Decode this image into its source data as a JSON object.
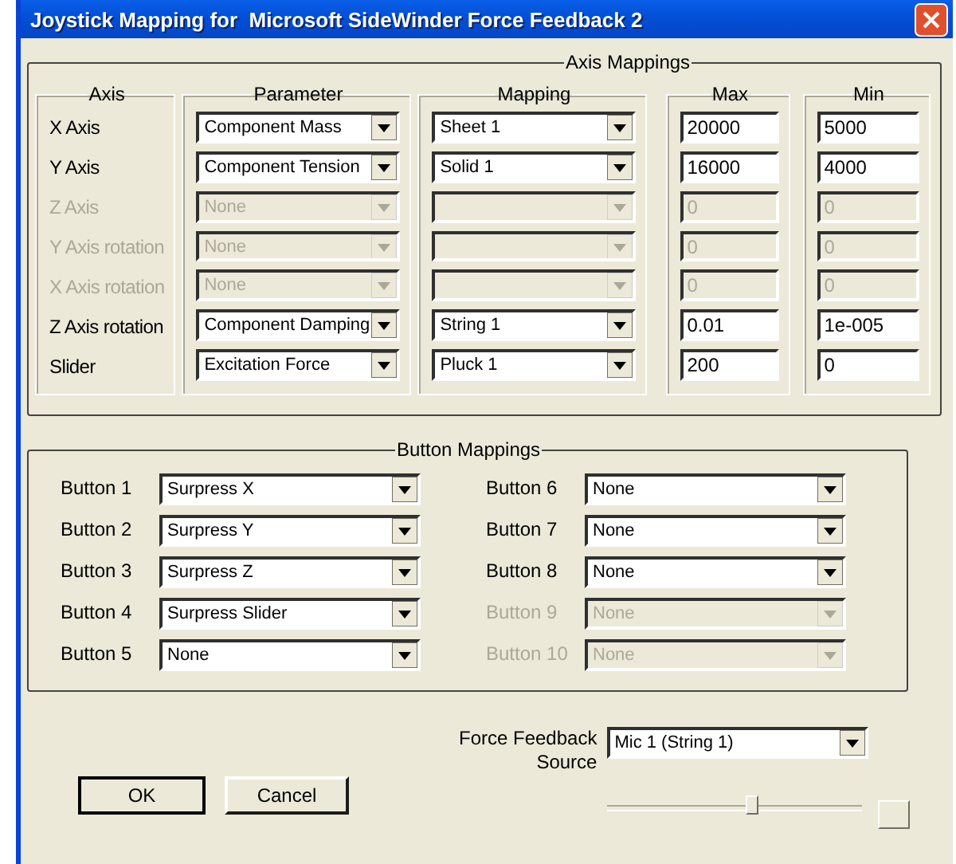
{
  "window": {
    "title": "Joystick Mapping for  Microsoft SideWinder Force Feedback 2"
  },
  "axis_mappings": {
    "title": "Axis Mappings",
    "headers": {
      "axis": "Axis",
      "parameter": "Parameter",
      "mapping": "Mapping",
      "max": "Max",
      "min": "Min"
    },
    "rows": [
      {
        "axis": "X Axis",
        "disabled": false,
        "parameter": "Component Mass",
        "mapping": "Sheet 1",
        "max": "20000",
        "min": "5000"
      },
      {
        "axis": "Y Axis",
        "disabled": false,
        "parameter": "Component Tension",
        "mapping": "Solid 1",
        "max": "16000",
        "min": "4000"
      },
      {
        "axis": "Z Axis",
        "disabled": true,
        "parameter": "None",
        "mapping": null,
        "max": "0",
        "min": "0"
      },
      {
        "axis": "Y Axis rotation",
        "disabled": true,
        "parameter": "None",
        "mapping": null,
        "max": "0",
        "min": "0"
      },
      {
        "axis": "X Axis rotation",
        "disabled": true,
        "parameter": "None",
        "mapping": null,
        "max": "0",
        "min": "0"
      },
      {
        "axis": "Z Axis rotation",
        "disabled": false,
        "parameter": "Component Damping",
        "mapping": "String 1",
        "max": "0.01",
        "min": "1e-005"
      },
      {
        "axis": "Slider",
        "disabled": false,
        "parameter": "Excitation Force",
        "mapping": "Pluck 1",
        "max": "200",
        "min": "0"
      }
    ]
  },
  "button_mappings": {
    "title": "Button Mappings",
    "buttons": [
      {
        "label": "Button 1",
        "value": "Surpress X",
        "disabled": false
      },
      {
        "label": "Button 2",
        "value": "Surpress Y",
        "disabled": false
      },
      {
        "label": "Button 3",
        "value": "Surpress Z",
        "disabled": false
      },
      {
        "label": "Button 4",
        "value": "Surpress Slider",
        "disabled": false
      },
      {
        "label": "Button 5",
        "value": "None",
        "disabled": false
      },
      {
        "label": "Button 6",
        "value": "None",
        "disabled": false
      },
      {
        "label": "Button 7",
        "value": "None",
        "disabled": false
      },
      {
        "label": "Button 8",
        "value": "None",
        "disabled": false
      },
      {
        "label": "Button 9",
        "value": "None",
        "disabled": true
      },
      {
        "label": "Button 10",
        "value": "None",
        "disabled": true
      }
    ]
  },
  "force_feedback": {
    "label_line1": "Force Feedback",
    "label_line2": "Source",
    "value": "Mic 1 (String 1)",
    "slider": {
      "level": 0.57
    }
  },
  "buttons": [
    {
      "label": "OK",
      "default": true
    },
    {
      "label": "Cancel",
      "default": false
    }
  ]
}
